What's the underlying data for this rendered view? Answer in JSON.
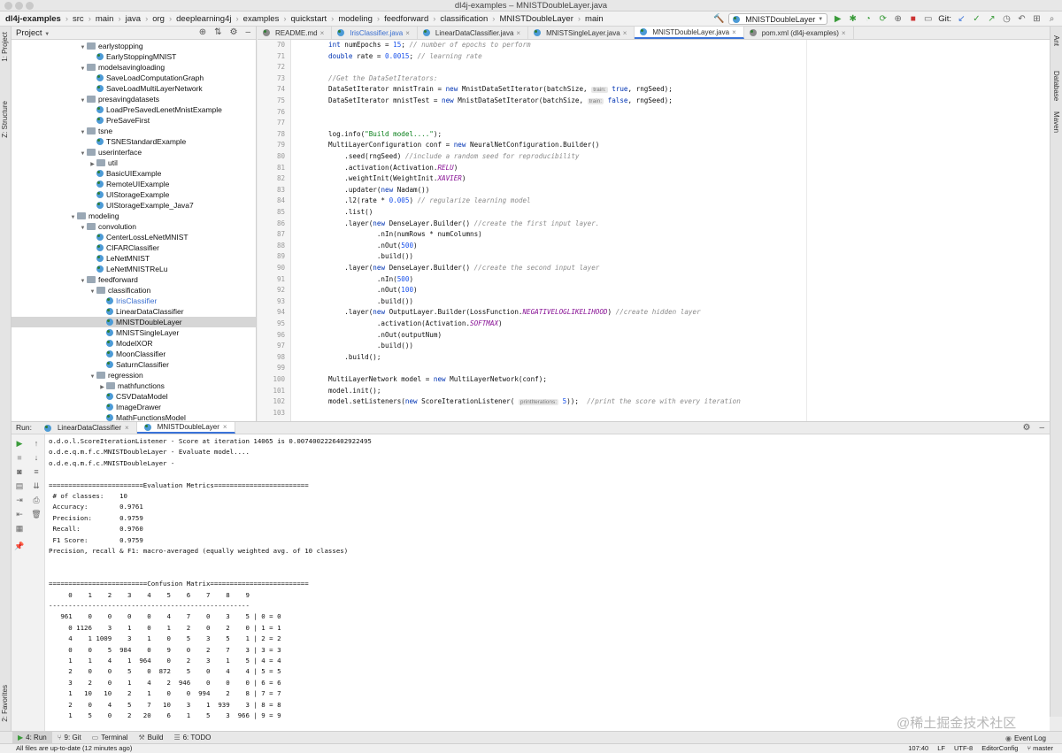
{
  "window": {
    "title": "dl4j-examples – MNISTDoubleLayer.java"
  },
  "breadcrumbs": [
    "dl4j-examples",
    "src",
    "main",
    "java",
    "org",
    "deeplearning4j",
    "examples",
    "quickstart",
    "modeling",
    "feedforward",
    "classification",
    "MNISTDoubleLayer",
    "main"
  ],
  "toolbar": {
    "run_config": "MNISTDoubleLayer",
    "git_label": "Git:"
  },
  "left_strip": {
    "project_tab": "1: Project",
    "structure_tab": "Z: Structure",
    "favorites_tab": "2: Favorites"
  },
  "right_strip": {
    "ant": "Ant",
    "database": "Database",
    "maven": "Maven"
  },
  "project": {
    "title": "Project",
    "tree": [
      {
        "label": "earlystopping",
        "type": "folder",
        "depth": 7,
        "open": true
      },
      {
        "label": "EarlyStoppingMNIST",
        "type": "class",
        "depth": 8
      },
      {
        "label": "modelsavingloading",
        "type": "folder",
        "depth": 7,
        "open": true
      },
      {
        "label": "SaveLoadComputationGraph",
        "type": "class",
        "depth": 8
      },
      {
        "label": "SaveLoadMultiLayerNetwork",
        "type": "class",
        "depth": 8
      },
      {
        "label": "presavingdatasets",
        "type": "folder",
        "depth": 7,
        "open": true
      },
      {
        "label": "LoadPreSavedLenetMnistExample",
        "type": "class",
        "depth": 8
      },
      {
        "label": "PreSaveFirst",
        "type": "class",
        "depth": 8
      },
      {
        "label": "tsne",
        "type": "folder",
        "depth": 7,
        "open": true
      },
      {
        "label": "TSNEStandardExample",
        "type": "class",
        "depth": 8
      },
      {
        "label": "userinterface",
        "type": "folder",
        "depth": 7,
        "open": true
      },
      {
        "label": "util",
        "type": "folder",
        "depth": 8,
        "open": false
      },
      {
        "label": "BasicUIExample",
        "type": "class",
        "depth": 8
      },
      {
        "label": "RemoteUIExample",
        "type": "class",
        "depth": 8
      },
      {
        "label": "UIStorageExample",
        "type": "class",
        "depth": 8
      },
      {
        "label": "UIStorageExample_Java7",
        "type": "class",
        "depth": 8
      },
      {
        "label": "modeling",
        "type": "folder",
        "depth": 6,
        "open": true
      },
      {
        "label": "convolution",
        "type": "folder",
        "depth": 7,
        "open": true
      },
      {
        "label": "CenterLossLeNetMNIST",
        "type": "class",
        "depth": 8
      },
      {
        "label": "CIFARClassifier",
        "type": "class",
        "depth": 8
      },
      {
        "label": "LeNetMNIST",
        "type": "class",
        "depth": 8
      },
      {
        "label": "LeNetMNISTReLu",
        "type": "class",
        "depth": 8
      },
      {
        "label": "feedforward",
        "type": "folder",
        "depth": 7,
        "open": true
      },
      {
        "label": "classification",
        "type": "folder",
        "depth": 8,
        "open": true
      },
      {
        "label": "IrisClassifier",
        "type": "class",
        "depth": 9,
        "link": true
      },
      {
        "label": "LinearDataClassifier",
        "type": "class",
        "depth": 9
      },
      {
        "label": "MNISTDoubleLayer",
        "type": "class",
        "depth": 9,
        "selected": true
      },
      {
        "label": "MNISTSingleLayer",
        "type": "class",
        "depth": 9
      },
      {
        "label": "ModelXOR",
        "type": "class",
        "depth": 9
      },
      {
        "label": "MoonClassifier",
        "type": "class",
        "depth": 9
      },
      {
        "label": "SaturnClassifier",
        "type": "class",
        "depth": 9
      },
      {
        "label": "regression",
        "type": "folder",
        "depth": 8,
        "open": true
      },
      {
        "label": "mathfunctions",
        "type": "folder",
        "depth": 9,
        "open": false
      },
      {
        "label": "CSVDataModel",
        "type": "class",
        "depth": 9
      },
      {
        "label": "ImageDrawer",
        "type": "class",
        "depth": 9
      },
      {
        "label": "MathFunctionsModel",
        "type": "class",
        "depth": 9
      }
    ]
  },
  "editor": {
    "tabs": [
      {
        "label": "README.md",
        "active": false,
        "link": false
      },
      {
        "label": "IrisClassifier.java",
        "active": false,
        "link": true
      },
      {
        "label": "LinearDataClassifier.java",
        "active": false,
        "link": false
      },
      {
        "label": "MNISTSingleLayer.java",
        "active": false,
        "link": false
      },
      {
        "label": "MNISTDoubleLayer.java",
        "active": true,
        "link": false
      },
      {
        "label": "pom.xml (dl4j-examples)",
        "active": false,
        "link": false
      }
    ],
    "lines": [
      {
        "n": "70",
        "html": "<span class=\"kw\">int</span> numEpochs = <span class=\"nu\">15</span>; <span class=\"cm\">// number of epochs to perform</span>"
      },
      {
        "n": "71",
        "html": "<span class=\"kw\">double</span> rate = <span class=\"nu\">0.0015</span>; <span class=\"cm\">// learning rate</span>"
      },
      {
        "n": "72",
        "html": ""
      },
      {
        "n": "73",
        "html": "<span class=\"cm\">//Get the DataSetIterators:</span>"
      },
      {
        "n": "74",
        "html": "DataSetIterator mnistTrain = <span class=\"kw\">new</span> MnistDataSetIterator(batchSize, <span class=\"hint\">train:</span> <span class=\"kw\">true</span>, rngSeed);"
      },
      {
        "n": "75",
        "html": "DataSetIterator mnistTest = <span class=\"kw\">new</span> MnistDataSetIterator(batchSize, <span class=\"hint\">train:</span> <span class=\"kw\">false</span>, rngSeed);"
      },
      {
        "n": "76",
        "html": ""
      },
      {
        "n": "77",
        "html": ""
      },
      {
        "n": "78",
        "html": "log.info(<span class=\"st\">\"Build model....\"</span>);"
      },
      {
        "n": "79",
        "html": "MultiLayerConfiguration conf = <span class=\"kw\">new</span> NeuralNetConfiguration.Builder()"
      },
      {
        "n": "80",
        "html": "    .seed(rngSeed) <span class=\"cm\">//include a random seed for reproducibility</span>"
      },
      {
        "n": "81",
        "html": "    .activation(Activation.<span class=\"it\">RELU</span>)"
      },
      {
        "n": "82",
        "html": "    .weightInit(WeightInit.<span class=\"it\">XAVIER</span>)"
      },
      {
        "n": "83",
        "html": "    .updater(<span class=\"kw\">new</span> Nadam())"
      },
      {
        "n": "84",
        "html": "    .l2(rate * <span class=\"nu\">0.005</span>) <span class=\"cm\">// regularize learning model</span>"
      },
      {
        "n": "85",
        "html": "    .list()"
      },
      {
        "n": "86",
        "html": "    .layer(<span class=\"kw\">new</span> DenseLayer.Builder() <span class=\"cm\">//create the first input layer.</span>"
      },
      {
        "n": "87",
        "html": "            .nIn(numRows * numColumns)"
      },
      {
        "n": "88",
        "html": "            .nOut(<span class=\"nu\">500</span>)"
      },
      {
        "n": "89",
        "html": "            .build())"
      },
      {
        "n": "90",
        "html": "    .layer(<span class=\"kw\">new</span> DenseLayer.Builder() <span class=\"cm\">//create the second input layer</span>"
      },
      {
        "n": "91",
        "html": "            .nIn(<span class=\"nu\">500</span>)"
      },
      {
        "n": "92",
        "html": "            .nOut(<span class=\"nu\">100</span>)"
      },
      {
        "n": "93",
        "html": "            .build())"
      },
      {
        "n": "94",
        "html": "    .layer(<span class=\"kw\">new</span> OutputLayer.Builder(LossFunction.<span class=\"it\">NEGATIVELOGLIKELIHOOD</span>) <span class=\"cm\">//create hidden layer</span>"
      },
      {
        "n": "95",
        "html": "            .activation(Activation.<span class=\"it\">SOFTMAX</span>)"
      },
      {
        "n": "96",
        "html": "            .nOut(outputNum)"
      },
      {
        "n": "97",
        "html": "            .build())"
      },
      {
        "n": "98",
        "html": "    .build();"
      },
      {
        "n": "99",
        "html": ""
      },
      {
        "n": "100",
        "html": "MultiLayerNetwork model = <span class=\"kw\">new</span> MultiLayerNetwork(conf);"
      },
      {
        "n": "101",
        "html": "model.init();"
      },
      {
        "n": "102",
        "html": "model.setListeners(<span class=\"kw\">new</span> ScoreIterationListener( <span class=\"hint\">printIterations:</span> <span class=\"nu\">5</span>));  <span class=\"cm\">//print the score with every iteration</span>"
      },
      {
        "n": "103",
        "html": ""
      }
    ]
  },
  "run": {
    "label": "Run:",
    "tabs": [
      {
        "label": "LinearDataClassifier",
        "active": false
      },
      {
        "label": "MNISTDoubleLayer",
        "active": true
      }
    ],
    "output": [
      "o.d.o.l.ScoreIterationListener - Score at iteration 14065 is 0.0074002226402922495",
      "o.d.e.q.m.f.c.MNISTDoubleLayer - Evaluate model....",
      "o.d.e.q.m.f.c.MNISTDoubleLayer -",
      "",
      "========================Evaluation Metrics========================",
      " # of classes:    10",
      " Accuracy:        0.9761",
      " Precision:       0.9759",
      " Recall:          0.9760",
      " F1 Score:        0.9759",
      "Precision, recall & F1: macro-averaged (equally weighted avg. of 10 classes)",
      "",
      "",
      "=========================Confusion Matrix=========================",
      "     0    1    2    3    4    5    6    7    8    9",
      "---------------------------------------------------",
      "   961    0    0    0    0    4    7    0    3    5 | 0 = 0",
      "     0 1126    3    1    0    1    2    0    2    0 | 1 = 1",
      "     4    1 1009    3    1    0    5    3    5    1 | 2 = 2",
      "     0    0    5  984    0    9    0    2    7    3 | 3 = 3",
      "     1    1    4    1  964    0    2    3    1    5 | 4 = 4",
      "     2    0    0    5    0  872    5    0    4    4 | 5 = 5",
      "     3    2    0    1    4    2  946    0    0    0 | 6 = 6",
      "     1   10   10    2    1    0    0  994    2    8 | 7 = 7",
      "     2    0    4    5    7   10    3    1  939    3 | 8 = 8",
      "     1    5    0    2   20    6    1    5    3  966 | 9 = 9"
    ]
  },
  "bottom_tabs": [
    {
      "label": "4: Run",
      "active": true
    },
    {
      "label": "9: Git",
      "active": false
    },
    {
      "label": "Terminal",
      "active": false
    },
    {
      "label": "Build",
      "active": false
    },
    {
      "label": "6: TODO",
      "active": false
    }
  ],
  "event_log": "Event Log",
  "status": {
    "message": "All files are up-to-date (12 minutes ago)",
    "position": "107:40",
    "line_sep": "LF",
    "encoding": "UTF-8",
    "editorconfig": "EditorConfig",
    "branch": "master"
  },
  "watermark": "@稀土掘金技术社区"
}
